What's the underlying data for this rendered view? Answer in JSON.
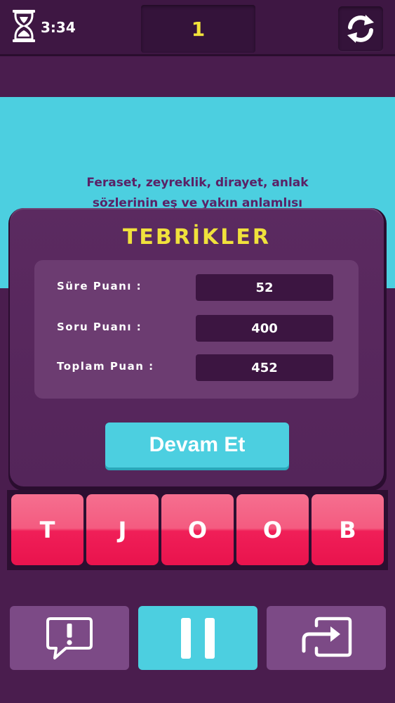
{
  "header": {
    "timer": "3:34",
    "level": "1",
    "icons": {
      "timer": "hourglass-icon",
      "refresh": "refresh-icon"
    }
  },
  "question": {
    "line1": "Feraset, zeyreklik, dirayet, anlak",
    "line2": "sözlerinin eş ve yakın anlamlısı"
  },
  "result": {
    "title": "TEBRİKLER",
    "rows": [
      {
        "label": "Süre Puanı :",
        "value": "52"
      },
      {
        "label": "Soru Puanı :",
        "value": "400"
      },
      {
        "label": "Toplam Puan :",
        "value": "452"
      }
    ],
    "continue_label": "Devam Et"
  },
  "tiles": [
    "T",
    "J",
    "O",
    "O",
    "B"
  ],
  "controls": {
    "hint_icon": "hint-icon",
    "pause_icon": "pause-icon",
    "skip_icon": "skip-icon"
  },
  "colors": {
    "background": "#4a1d4e",
    "accent_cyan": "#4ccfe0",
    "tile_pink": "#f01f58",
    "title_yellow": "#f0e13c"
  }
}
